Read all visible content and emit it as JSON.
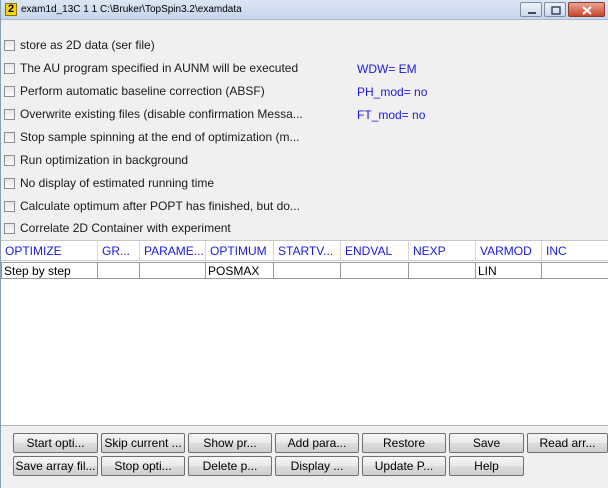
{
  "window": {
    "badge": "2",
    "title": "exam1d_13C  1  1  C:\\Bruker\\TopSpin3.2\\examdata"
  },
  "options": [
    {
      "label": "store as 2D data (ser file)",
      "checked": false
    },
    {
      "label": "The AU program specified in AUNM will be executed",
      "checked": false
    },
    {
      "label": "Perform automatic baseline correction (ABSF)",
      "checked": false
    },
    {
      "label": "Overwrite existing files (disable confirmation Messa...",
      "checked": false
    },
    {
      "label": "Stop sample spinning at the end of optimization (m...",
      "checked": false
    },
    {
      "label": "Run optimization in background",
      "checked": false
    },
    {
      "label": "No display of estimated running time",
      "checked": false
    },
    {
      "label": "Calculate optimum after POPT has finished, but do...",
      "checked": false
    },
    {
      "label": "Correlate 2D Container with experiment",
      "checked": false
    }
  ],
  "params": {
    "wdw": "WDW= EM",
    "ph_mod": "PH_mod= no",
    "ft_mod": "FT_mod= no"
  },
  "table": {
    "headers": [
      "OPTIMIZE",
      "GR...",
      "PARAME...",
      "OPTIMUM",
      "STARTV...",
      "ENDVAL",
      "NEXP",
      "VARMOD",
      "INC"
    ],
    "rows": [
      [
        "Step by step",
        "",
        "",
        "POSMAX",
        "",
        "",
        "",
        "LIN",
        ""
      ]
    ]
  },
  "buttons_row1": [
    "Start opti...",
    "Skip current ...",
    "Show pr...",
    "Add para...",
    "Restore",
    "Save",
    "Read arr..."
  ],
  "buttons_row2": [
    "Save array fil...",
    "Stop opti...",
    "Delete p...",
    "Display ...",
    "Update P...",
    "Help"
  ],
  "colors": {
    "header_text": "#1a1ae6",
    "param_text": "#1a1ae6",
    "title_badge": "#f5d400"
  }
}
